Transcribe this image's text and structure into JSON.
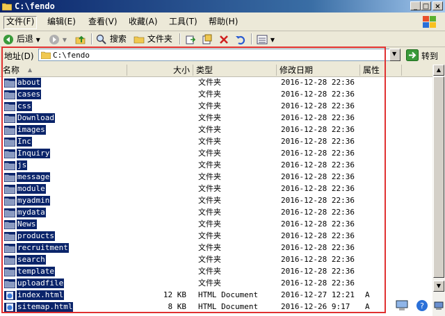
{
  "title": "C:\\fendo",
  "window_buttons": [
    "_",
    "□",
    "×"
  ],
  "menu": [
    "文件(F)",
    "编辑(E)",
    "查看(V)",
    "收藏(A)",
    "工具(T)",
    "帮助(H)"
  ],
  "toolbar": {
    "back_label": "后退",
    "search_label": "搜索",
    "folders_label": "文件夹"
  },
  "address": {
    "label": "地址(D)",
    "value": "C:\\fendo",
    "go_label": "转到"
  },
  "columns": {
    "name": "名称",
    "size": "大小",
    "type": "类型",
    "modified": "修改日期",
    "attr": "属性"
  },
  "files": [
    {
      "name": "about",
      "size": "",
      "type": "文件夹",
      "date": "2016-12-28 22:36",
      "attr": "",
      "kind": "folder"
    },
    {
      "name": "cases",
      "size": "",
      "type": "文件夹",
      "date": "2016-12-28 22:36",
      "attr": "",
      "kind": "folder"
    },
    {
      "name": "css",
      "size": "",
      "type": "文件夹",
      "date": "2016-12-28 22:36",
      "attr": "",
      "kind": "folder"
    },
    {
      "name": "Download",
      "size": "",
      "type": "文件夹",
      "date": "2016-12-28 22:36",
      "attr": "",
      "kind": "folder"
    },
    {
      "name": "images",
      "size": "",
      "type": "文件夹",
      "date": "2016-12-28 22:36",
      "attr": "",
      "kind": "folder"
    },
    {
      "name": "Inc",
      "size": "",
      "type": "文件夹",
      "date": "2016-12-28 22:36",
      "attr": "",
      "kind": "folder"
    },
    {
      "name": "Inquiry",
      "size": "",
      "type": "文件夹",
      "date": "2016-12-28 22:36",
      "attr": "",
      "kind": "folder"
    },
    {
      "name": "js",
      "size": "",
      "type": "文件夹",
      "date": "2016-12-28 22:36",
      "attr": "",
      "kind": "folder"
    },
    {
      "name": "message",
      "size": "",
      "type": "文件夹",
      "date": "2016-12-28 22:36",
      "attr": "",
      "kind": "folder"
    },
    {
      "name": "module",
      "size": "",
      "type": "文件夹",
      "date": "2016-12-28 22:36",
      "attr": "",
      "kind": "folder"
    },
    {
      "name": "myadmin",
      "size": "",
      "type": "文件夹",
      "date": "2016-12-28 22:36",
      "attr": "",
      "kind": "folder"
    },
    {
      "name": "mydata",
      "size": "",
      "type": "文件夹",
      "date": "2016-12-28 22:36",
      "attr": "",
      "kind": "folder"
    },
    {
      "name": "News",
      "size": "",
      "type": "文件夹",
      "date": "2016-12-28 22:36",
      "attr": "",
      "kind": "folder"
    },
    {
      "name": "products",
      "size": "",
      "type": "文件夹",
      "date": "2016-12-28 22:36",
      "attr": "",
      "kind": "folder"
    },
    {
      "name": "recruitment",
      "size": "",
      "type": "文件夹",
      "date": "2016-12-28 22:36",
      "attr": "",
      "kind": "folder"
    },
    {
      "name": "search",
      "size": "",
      "type": "文件夹",
      "date": "2016-12-28 22:36",
      "attr": "",
      "kind": "folder"
    },
    {
      "name": "template",
      "size": "",
      "type": "文件夹",
      "date": "2016-12-28 22:36",
      "attr": "",
      "kind": "folder"
    },
    {
      "name": "uploadfile",
      "size": "",
      "type": "文件夹",
      "date": "2016-12-28 22:36",
      "attr": "",
      "kind": "folder"
    },
    {
      "name": "index.html",
      "size": "12 KB",
      "type": "HTML Document",
      "date": "2016-12-27 12:21",
      "attr": "A",
      "kind": "html"
    },
    {
      "name": "sitemap.html",
      "size": "8 KB",
      "type": "HTML Document",
      "date": "2016-12-26 9:17",
      "attr": "A",
      "kind": "html"
    }
  ],
  "colors": {
    "selection": "#0a246a",
    "highlight_box": "#e03030",
    "title_bar": "#0a246a"
  }
}
